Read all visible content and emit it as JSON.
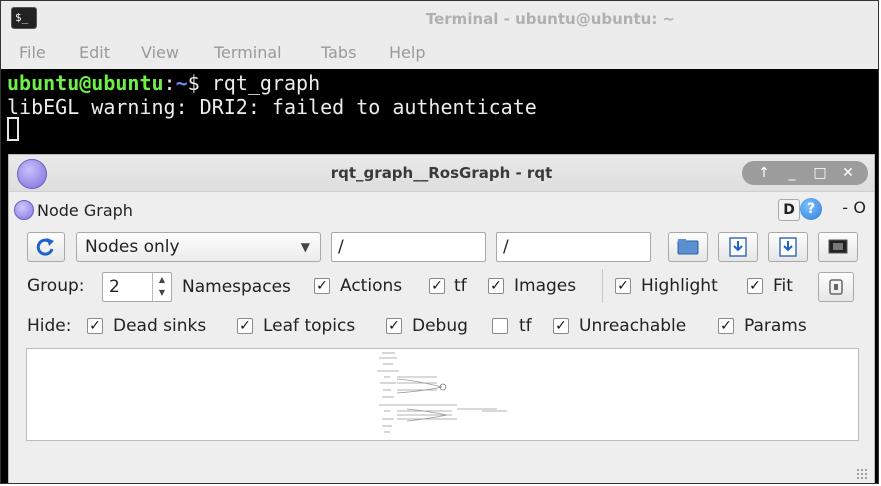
{
  "terminal": {
    "title": "Terminal - ubuntu@ubuntu: ~",
    "menu": [
      "File",
      "Edit",
      "View",
      "Terminal",
      "Tabs",
      "Help"
    ],
    "prompt_user": "ubuntu@ubuntu",
    "prompt_sep": ":",
    "prompt_path": "~",
    "prompt_symbol": "$ ",
    "command": "rqt_graph",
    "output": "libEGL warning: DRI2: failed to authenticate"
  },
  "rqt": {
    "title": "rqt_graph__RosGraph - rqt",
    "window_controls": [
      "↑",
      "_",
      "□",
      "✕"
    ],
    "pane_title": "Node Graph",
    "pane_controls": {
      "d": "D",
      "help": "?",
      "dash": "-",
      "o": "O"
    },
    "toolbar": {
      "mode": "Nodes only",
      "node_filter": "/",
      "topic_filter": "/"
    },
    "group": {
      "label": "Group:",
      "value": "2"
    },
    "options": [
      {
        "label": "Namespaces",
        "checked": true
      },
      {
        "label": "Actions",
        "checked": true
      },
      {
        "label": "tf",
        "checked": true
      },
      {
        "label": "Images",
        "checked": true
      },
      {
        "label": "Highlight",
        "checked": true
      },
      {
        "label": "Fit",
        "checked": true
      }
    ],
    "hide": {
      "label": "Hide:",
      "items": [
        {
          "label": "Dead sinks",
          "checked": true
        },
        {
          "label": "Leaf topics",
          "checked": true
        },
        {
          "label": "Debug",
          "checked": true
        },
        {
          "label": "tf",
          "checked": false
        },
        {
          "label": "Unreachable",
          "checked": true
        },
        {
          "label": "Params",
          "checked": true
        }
      ]
    }
  },
  "colors": {
    "terminal_bg": "#000000",
    "prompt_user": "#6ef04a",
    "prompt_path": "#6b8cff",
    "window_bg": "#eeeeee"
  },
  "icons": [
    "terminal-app-icon",
    "rqt-logo-icon",
    "refresh-icon",
    "open-folder-icon",
    "save-icon",
    "save-image-icon",
    "screenshot-icon",
    "fit-view-icon",
    "help-icon"
  ]
}
